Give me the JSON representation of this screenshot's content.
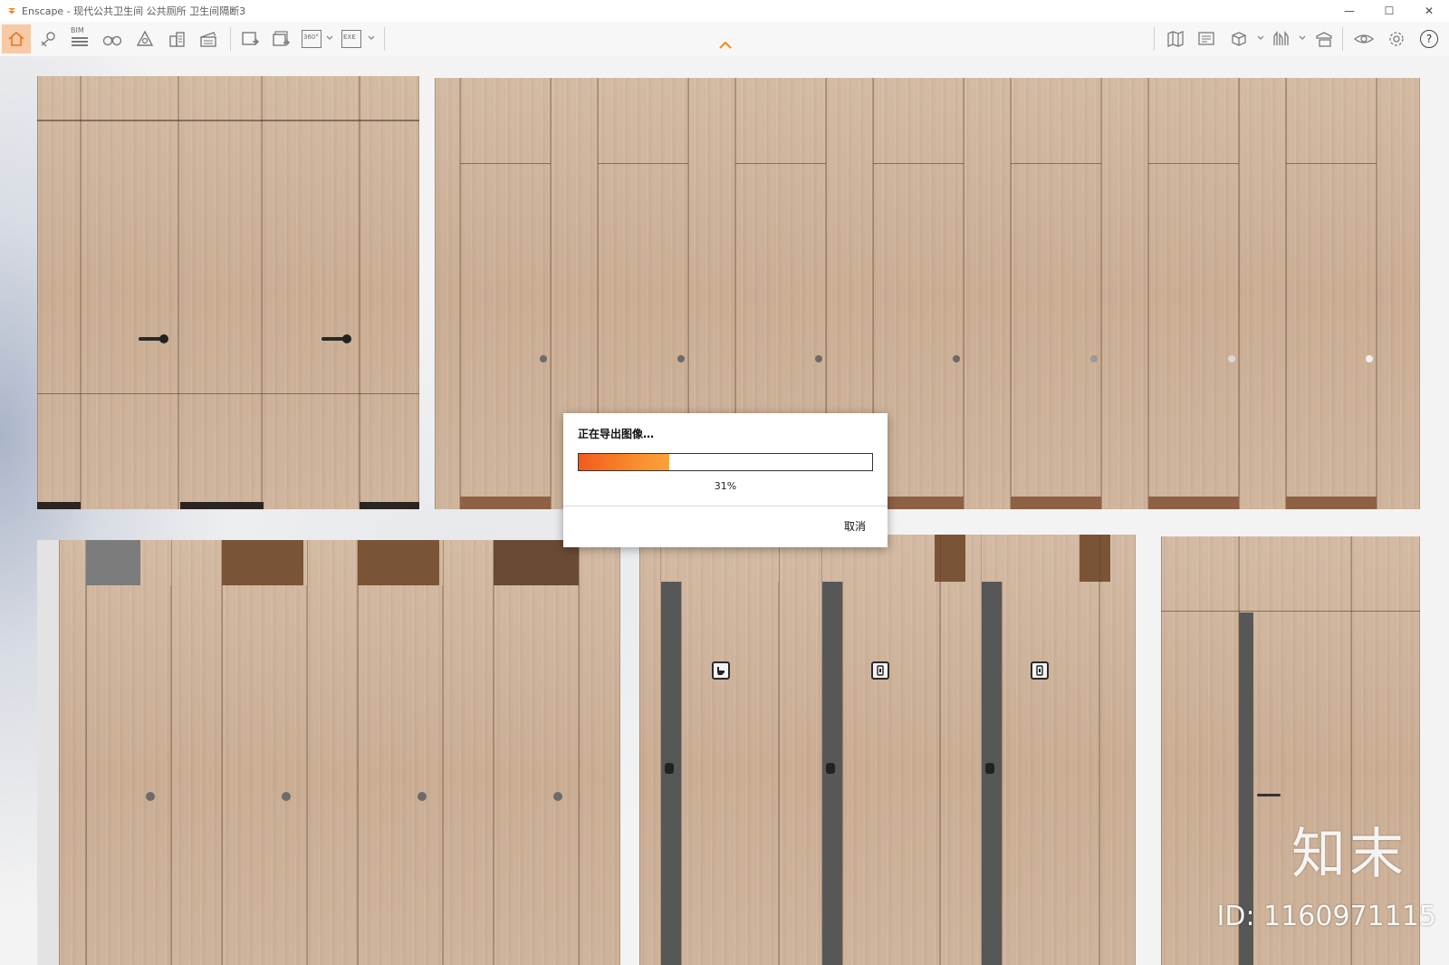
{
  "window": {
    "app_name": "Enscape",
    "title_separator": " - ",
    "document_title": "现代公共卫生间 公共厕所 卫生间隔断3",
    "minimize_glyph": "—",
    "maximize_glyph": "☐",
    "close_glyph": "✕"
  },
  "toolbar": {
    "bim_label": "BIM",
    "panorama_label": "360°",
    "exe_label": "EXE",
    "help_glyph": "?",
    "icons": [
      "home-icon",
      "map-pin-icon",
      "bim-info-icon",
      "binoculars-icon",
      "atmosphere-icon",
      "buildings-icon",
      "clapper-icon",
      "render-image-icon",
      "batch-render-icon",
      "panorama-icon",
      "export-exe-icon",
      "map-icon",
      "screen-capture-icon",
      "cube-icon",
      "sketch-icon",
      "asset-library-icon",
      "visual-settings-icon",
      "settings-gear-icon",
      "help-icon"
    ]
  },
  "dialog": {
    "title": "正在导出图像…",
    "progress_percent": 31,
    "progress_text": "31%",
    "cancel_label": "取消"
  },
  "overlay": {
    "watermark_logo": "知末",
    "watermark_id": "ID: 1160971115"
  },
  "colors": {
    "accent_orange": "#f7941e",
    "active_tab": "#f7c9a4",
    "wood": "#cdb198"
  }
}
